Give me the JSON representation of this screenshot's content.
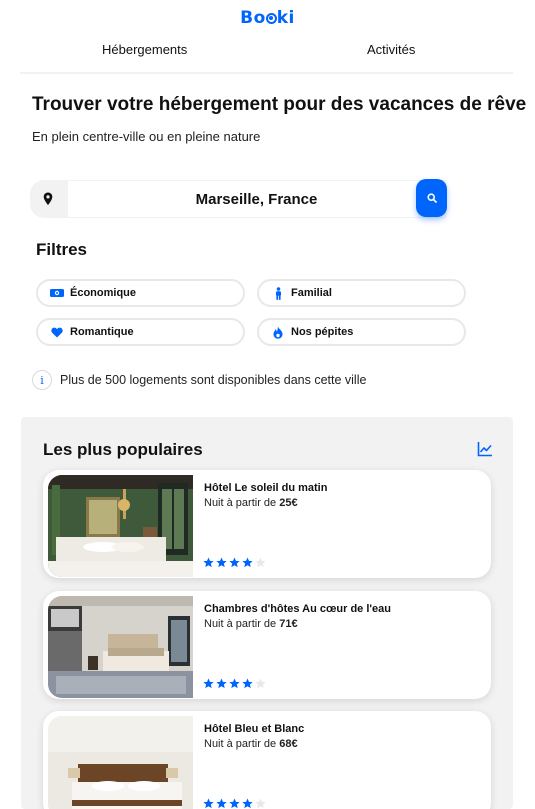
{
  "brand": {
    "logo_prefix": "Bo",
    "logo_suffix": "ki",
    "accent": "#0065FC"
  },
  "nav": {
    "items": [
      {
        "label": "Hébergements"
      },
      {
        "label": "Activités"
      }
    ]
  },
  "hero": {
    "title": "Trouver votre hébergement pour des vacances de rêve",
    "subtitle": "En plein centre-ville ou en pleine nature"
  },
  "search": {
    "value": "Marseille, France",
    "location_icon": "map-pin-icon",
    "button_icon": "search-icon"
  },
  "filters": {
    "title": "Filtres",
    "items": [
      {
        "label": "Économique",
        "icon": "money-icon"
      },
      {
        "label": "Familial",
        "icon": "person-icon"
      },
      {
        "label": "Romantique",
        "icon": "heart-icon"
      },
      {
        "label": "Nos pépites",
        "icon": "fire-icon"
      }
    ]
  },
  "info": {
    "icon": "info-icon",
    "text": "Plus de 500 logements sont disponibles dans cette ville"
  },
  "popular": {
    "title": "Les plus populaires",
    "icon": "trending-chart-icon",
    "hotels": [
      {
        "name": "Hôtel Le soleil du matin",
        "price_prefix": "Nuit à partir de ",
        "price": "25€",
        "rating": 4,
        "max_rating": 5
      },
      {
        "name": "Chambres d'hôtes Au cœur de l'eau",
        "price_prefix": "Nuit à partir de ",
        "price": "71€",
        "rating": 4,
        "max_rating": 5
      },
      {
        "name": "Hôtel Bleu et Blanc",
        "price_prefix": "Nuit à partir de ",
        "price": "68€",
        "rating": 4,
        "max_rating": 5
      }
    ]
  }
}
